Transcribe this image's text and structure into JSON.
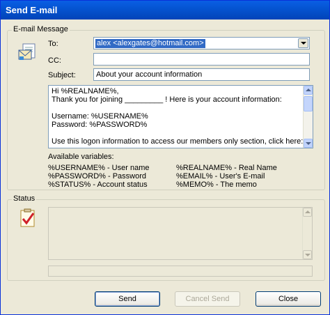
{
  "window": {
    "title": "Send E-mail"
  },
  "message_group": {
    "legend": "E-mail Message",
    "to_label": "To:",
    "to_value": "alex <alexgates@hotmail.com>",
    "cc_label": "CC:",
    "cc_value": "",
    "subject_label": "Subject:",
    "subject_value": "About your account information",
    "body": "Hi %REALNAME%,\nThank you for joining _________ ! Here is your account information:\n\nUsername: %USERNAME%\nPassword: %PASSWORD%\n\nUse this logon information to access our members only section, click here:",
    "variables_label": "Available variables:",
    "variables_left": [
      "%USERNAME% - User name",
      "%PASSWORD% - Password",
      "%STATUS% - Account status"
    ],
    "variables_right": [
      "%REALNAME% - Real Name",
      "%EMAIL% - User's E-mail",
      "%MEMO% - The memo"
    ]
  },
  "status_group": {
    "legend": "Status",
    "log_text": "",
    "progress": 0
  },
  "buttons": {
    "send": "Send",
    "cancel_send": "Cancel Send",
    "close": "Close"
  },
  "icons": {
    "message": "envelope-icon",
    "status": "checklist-icon"
  },
  "colors": {
    "titlebar": "#0453d0",
    "selection": "#316ac5",
    "face": "#ece9d8"
  }
}
